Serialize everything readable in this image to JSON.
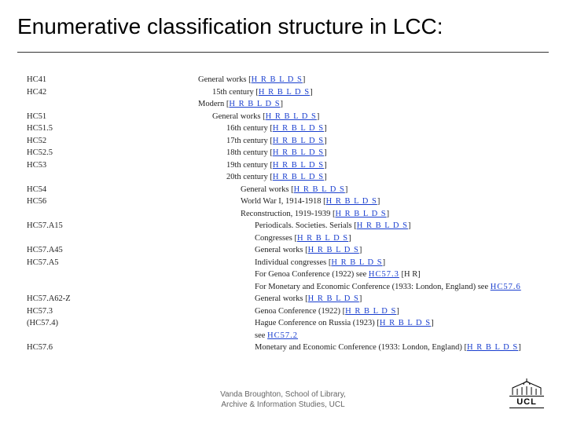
{
  "title": "Enumerative classification structure in LCC:",
  "link_label": "H R B L D S",
  "link_label_full": "H R B L D S",
  "rows": [
    {
      "code": "HC41",
      "indent": 0,
      "text": "General works",
      "links": "[H R B L D S]"
    },
    {
      "code": "HC42",
      "indent": 1,
      "text": "15th century",
      "links": "[H R B L D S]"
    },
    {
      "code": "",
      "indent": 0,
      "text": "Modern",
      "links": "[H R B L D S]"
    },
    {
      "code": "HC51",
      "indent": 1,
      "text": "General works",
      "links": "[H R B L D S]"
    },
    {
      "code": "HC51.5",
      "indent": 2,
      "text": "16th century",
      "links": "[H R B L D S]"
    },
    {
      "code": "HC52",
      "indent": 2,
      "text": "17th century",
      "links": "[H R B L D S]"
    },
    {
      "code": "HC52.5",
      "indent": 2,
      "text": "18th century",
      "links": "[H R B L D S]"
    },
    {
      "code": "HC53",
      "indent": 2,
      "text": "19th century",
      "links": "[H R B L D S]"
    },
    {
      "code": "",
      "indent": 2,
      "text": "20th century",
      "links": "[H R B L D S]"
    },
    {
      "code": "HC54",
      "indent": 3,
      "text": "General works",
      "links": "[H R B L D S]"
    },
    {
      "code": "HC56",
      "indent": 3,
      "text": "World War I, 1914-1918",
      "links": "[H R B L D S]"
    },
    {
      "code": "",
      "indent": 3,
      "text": "Reconstruction, 1919-1939",
      "links": "[H R B L D S]"
    },
    {
      "code": "HC57.A15",
      "indent": 4,
      "text": "Periodicals. Societies. Serials",
      "links": "[H R B L D S]"
    },
    {
      "code": "",
      "indent": 4,
      "text": "Congresses",
      "links": "[H R B L D S]"
    },
    {
      "code": "HC57.A45",
      "indent": 4,
      "text": "General works",
      "links": "[H R B L D S]"
    },
    {
      "code": "HC57.A5",
      "indent": 4,
      "text": "Individual congresses",
      "links": "[H R B L D S]"
    },
    {
      "code": "",
      "indent": 4,
      "text": "For Genoa Conference (1922) see ",
      "inline_link": "HC57.3",
      "tail": " [H R]"
    },
    {
      "code": "",
      "indent": 4,
      "text": "For Monetary and Economic Conference (1933: London, England) see ",
      "inline_link": "HC57.6",
      "tail": ""
    },
    {
      "code": "HC57.A62-Z",
      "indent": 4,
      "text": "General works",
      "links": "[H R B L D S]"
    },
    {
      "code": "HC57.3",
      "indent": 4,
      "text": "Genoa Conference (1922)",
      "links": "[H R B L D S]"
    },
    {
      "code": "(HC57.4)",
      "indent": 4,
      "text": "Hague Conference on Russia (1923)",
      "links": "[H R B L D S]"
    },
    {
      "code": "",
      "indent": 4,
      "text": "see ",
      "inline_link": "HC57.2",
      "tail": ""
    },
    {
      "code": "HC57.6",
      "indent": 4,
      "text": "Monetary and Economic Conference (1933: London, England)",
      "links": "[H R B L D S]"
    }
  ],
  "footer_line1": "Vanda Broughton, School of Library,",
  "footer_line2": "Archive & Information Studies, UCL",
  "ucl_label": "UCL"
}
